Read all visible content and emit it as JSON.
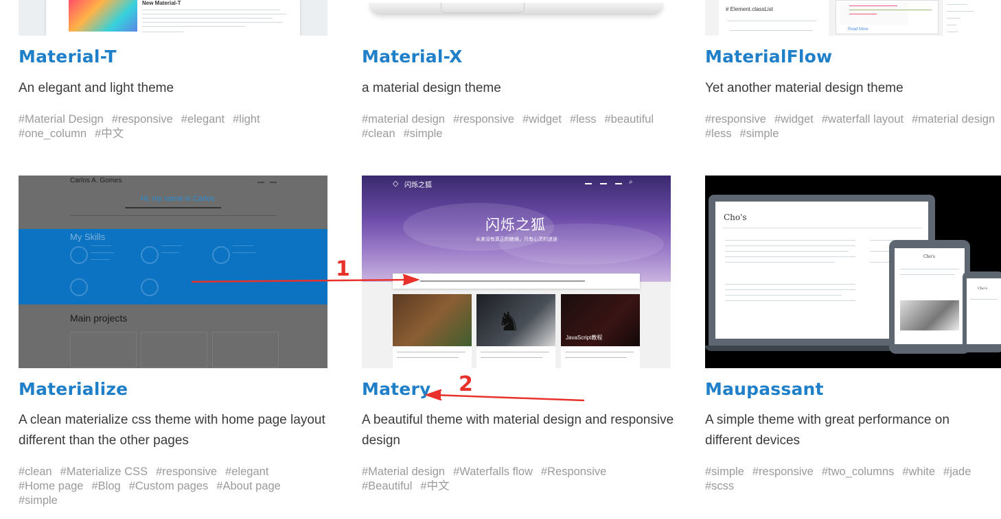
{
  "themes": [
    {
      "name": "Material-T",
      "description": "An elegant and light theme",
      "tags": [
        "#Material Design",
        "#responsive",
        "#elegant",
        "#light",
        "#one_column",
        "#中文"
      ],
      "preview_text": [
        "New Material-T"
      ]
    },
    {
      "name": "Material-X",
      "description": "a material design theme",
      "tags": [
        "#material design",
        "#responsive",
        "#widget",
        "#less",
        "#beautiful",
        "#clean",
        "#simple"
      ]
    },
    {
      "name": "MaterialFlow",
      "description": "Yet another material design theme",
      "tags": [
        "#responsive",
        "#widget",
        "#waterfall layout",
        "#material design",
        "#less",
        "#simple"
      ],
      "preview_text": [
        "# Element.classList",
        "Read More"
      ]
    },
    {
      "name": "Materialize",
      "description": "A clean materialize css theme with home page layout different than the other pages",
      "tags": [
        "#clean",
        "#Materialize CSS",
        "#responsive",
        "#elegant",
        "#Home page",
        "#Blog",
        "#Custom pages",
        "#About page",
        "#simple"
      ],
      "preview_text": [
        "Carlos A. Gomes",
        "Hi, my name is Carlos",
        "My Skills",
        "Main projects"
      ]
    },
    {
      "name": "Matery",
      "description": "A beautiful theme with material design and responsive design",
      "tags": [
        "#Material design",
        "#Waterfalls flow",
        "#Responsive",
        "#Beautiful",
        "#中文"
      ],
      "preview_text": [
        "闪烁之狐",
        "从来没有真正的绝境，只有心灵的迷途",
        "JavaScript教程"
      ]
    },
    {
      "name": "Maupassant",
      "description": "A simple theme with great performance on different devices",
      "tags": [
        "#simple",
        "#responsive",
        "#two_columns",
        "#white",
        "#jade",
        "#scss"
      ],
      "preview_text": [
        "Cho's"
      ]
    }
  ],
  "annotations": {
    "marker_1": "1",
    "marker_2": "2",
    "arrow_color": "#e8312a"
  },
  "colors": {
    "title": "#1f7fc8",
    "description": "#3a3a3a",
    "tag": "#9a9a9a"
  }
}
